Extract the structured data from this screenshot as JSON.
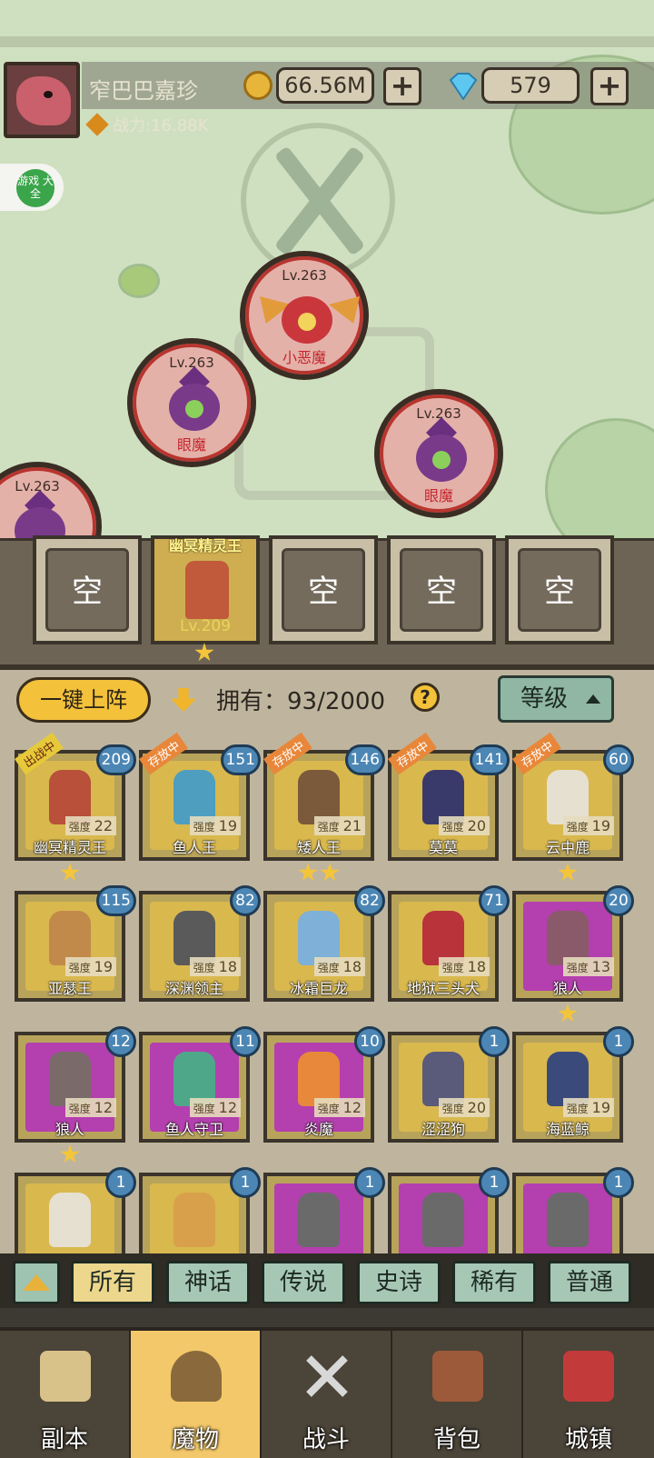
{
  "player": {
    "name": "窄巴巴嘉珍",
    "gold": "66.56M",
    "gems": "579",
    "plus": "+",
    "power": "战力:16.88K"
  },
  "badge": "游戏\n大全",
  "enemies": [
    {
      "level": "Lv.263",
      "name": "小恶魔"
    },
    {
      "level": "Lv.263",
      "name": "眼魔"
    },
    {
      "level": "Lv.263",
      "name": "眼魔"
    },
    {
      "level": "Lv.263",
      "name": ""
    }
  ],
  "lineup": {
    "empty": "空",
    "hero_name": "幽冥精灵王",
    "hero_level": "Lv.209"
  },
  "controls": {
    "deploy": "一键上阵",
    "owned": "拥有：93/2000",
    "help": "?",
    "sort": "等级"
  },
  "roster": [
    {
      "name": "幽冥精灵王",
      "power_label": "强度",
      "power": "22",
      "level": "209",
      "tag": "出战中",
      "color": "gold"
    },
    {
      "name": "鱼人王",
      "power_label": "强度",
      "power": "19",
      "level": "151",
      "tag": "存放中",
      "color": "gold"
    },
    {
      "name": "矮人王",
      "power_label": "强度",
      "power": "21",
      "level": "146",
      "tag": "存放中",
      "color": "gold"
    },
    {
      "name": "莫莫",
      "power_label": "强度",
      "power": "20",
      "level": "141",
      "tag": "存放中",
      "color": "gold"
    },
    {
      "name": "云中鹿",
      "power_label": "强度",
      "power": "19",
      "level": "60",
      "tag": "存放中",
      "color": "gold"
    },
    {
      "name": "亚瑟王",
      "power_label": "强度",
      "power": "19",
      "level": "115",
      "tag": "",
      "color": "gold"
    },
    {
      "name": "深渊领主",
      "power_label": "强度",
      "power": "18",
      "level": "82",
      "tag": "",
      "color": "gold"
    },
    {
      "name": "冰霜巨龙",
      "power_label": "强度",
      "power": "18",
      "level": "82",
      "tag": "",
      "color": "gold"
    },
    {
      "name": "地狱三头犬",
      "power_label": "强度",
      "power": "18",
      "level": "71",
      "tag": "",
      "color": "gold"
    },
    {
      "name": "狼人",
      "power_label": "强度",
      "power": "13",
      "level": "20",
      "tag": "",
      "color": "purple"
    },
    {
      "name": "狼人",
      "power_label": "强度",
      "power": "12",
      "level": "12",
      "tag": "",
      "color": "purple"
    },
    {
      "name": "鱼人守卫",
      "power_label": "强度",
      "power": "12",
      "level": "11",
      "tag": "",
      "color": "purple"
    },
    {
      "name": "炎魔",
      "power_label": "强度",
      "power": "12",
      "level": "10",
      "tag": "",
      "color": "purple"
    },
    {
      "name": "涩涩狗",
      "power_label": "强度",
      "power": "20",
      "level": "1",
      "tag": "",
      "color": "gold"
    },
    {
      "name": "海蓝鲸",
      "power_label": "强度",
      "power": "19",
      "level": "1",
      "tag": "",
      "color": "gold"
    },
    {
      "name": "",
      "power_label": "",
      "power": "",
      "level": "1",
      "tag": "",
      "color": "gold"
    },
    {
      "name": "",
      "power_label": "",
      "power": "",
      "level": "1",
      "tag": "",
      "color": "gold"
    },
    {
      "name": "",
      "power_label": "",
      "power": "",
      "level": "1",
      "tag": "",
      "color": "purple"
    },
    {
      "name": "",
      "power_label": "",
      "power": "",
      "level": "1",
      "tag": "",
      "color": "purple"
    },
    {
      "name": "",
      "power_label": "",
      "power": "",
      "level": "1",
      "tag": "",
      "color": "purple"
    }
  ],
  "filters": [
    "所有",
    "神话",
    "传说",
    "史诗",
    "稀有",
    "普通"
  ],
  "nav": [
    "副本",
    "魔物",
    "战斗",
    "背包",
    "城镇"
  ],
  "colors": {
    "gold_card": "#d9b84e",
    "purple_card": "#b43fae",
    "level_badge": "#4c86b4",
    "accent": "#f3c13a"
  }
}
